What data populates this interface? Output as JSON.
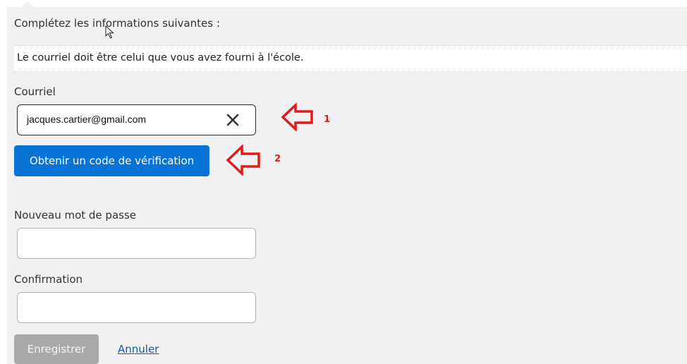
{
  "form": {
    "intro_text": "Complétez les informations suivantes :",
    "info_message": "Le courriel doit être celui que vous avez fourni à l'école.",
    "email_label": "Courriel",
    "email_value": "jacques.cartier@gmail.com",
    "verify_button_label": "Obtenir un code de vérification",
    "new_password_label": "Nouveau mot de passe",
    "new_password_value": "",
    "confirmation_label": "Confirmation",
    "confirmation_value": "",
    "save_button_label": "Enregistrer",
    "cancel_link_label": "Annuler"
  },
  "annotations": {
    "callout_1": "1",
    "callout_2": "2",
    "arrow_color": "#e01b1b"
  },
  "icons": {
    "clear": "close-icon",
    "cursor": "mouse-pointer-icon",
    "annotation_arrow": "left-arrow-outline-icon"
  },
  "colors": {
    "primary_button": "#0a74d6",
    "disabled_button": "#a9a9a9",
    "link": "#1558b0",
    "panel_background": "#f1f1f1"
  }
}
